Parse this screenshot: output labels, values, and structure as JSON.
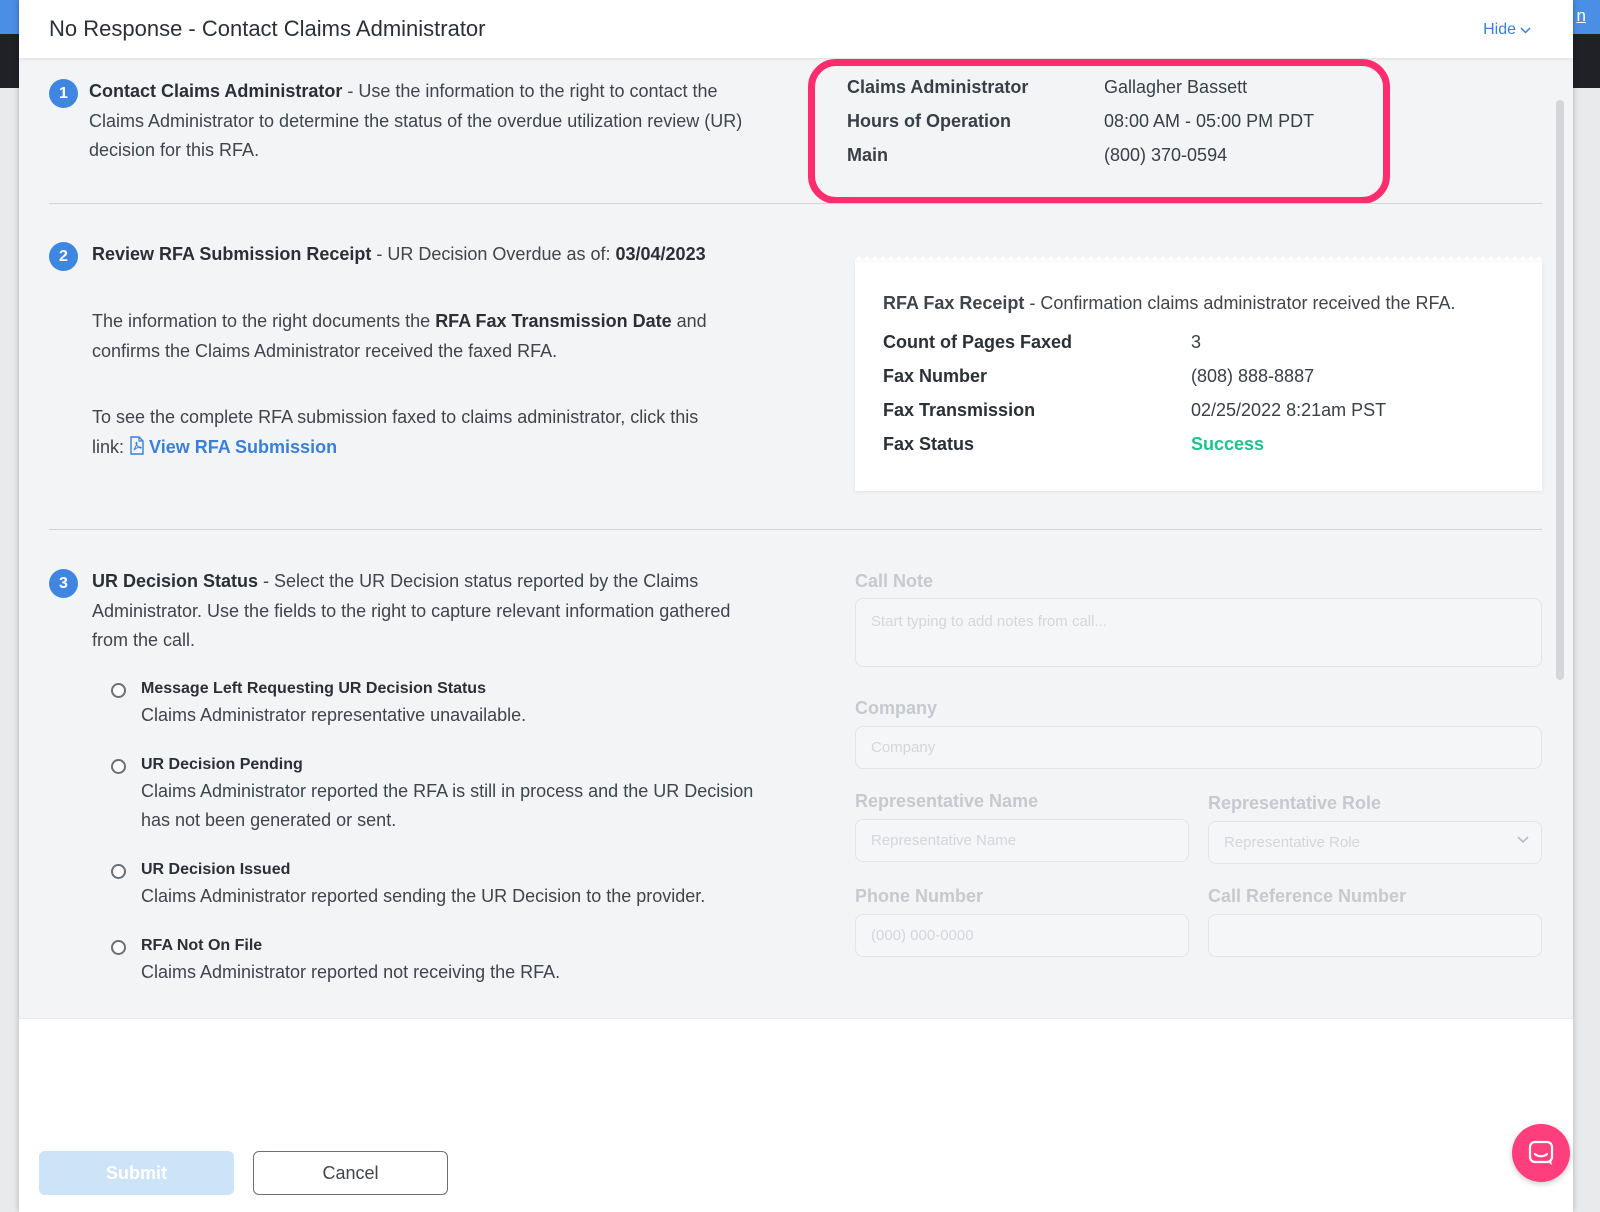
{
  "background": {
    "corner_link": "n"
  },
  "header": {
    "title": "No Response - Contact Claims Administrator",
    "hide_label": "Hide"
  },
  "step1": {
    "number": "1",
    "title": "Contact Claims Administrator",
    "text": " - Use the information to the right to contact the Claims Administrator to determine the status of the overdue utilization review (UR) decision for this RFA."
  },
  "claims_admin": {
    "rows": [
      {
        "label": "Claims Administrator",
        "value": "Gallagher Bassett"
      },
      {
        "label": "Hours of Operation",
        "value": "08:00 AM - 05:00 PM PDT"
      },
      {
        "label": "Main",
        "value": "(800) 370-0594"
      }
    ]
  },
  "step2": {
    "number": "2",
    "title": "Review RFA Submission Receipt",
    "subtitle": " - UR Decision Overdue as of: ",
    "date": "03/04/2023",
    "p1_a": "The information to the right documents the ",
    "p1_b": "RFA Fax Transmission Date",
    "p1_c": " and confirms the Claims Administrator received the faxed RFA.",
    "p2_a": "To see the complete RFA submission faxed to claims administrator, click this link: ",
    "link": "View RFA Submission"
  },
  "receipt": {
    "title": "RFA Fax Receipt",
    "subtitle": " - Confirmation claims administrator received the RFA.",
    "rows": [
      {
        "label": "Count of Pages Faxed",
        "value": "3"
      },
      {
        "label": "Fax Number",
        "value": "(808) 888-8887"
      },
      {
        "label": "Fax Transmission",
        "value": "02/25/2022 8:21am PST"
      },
      {
        "label": "Fax Status",
        "value": "Success"
      }
    ]
  },
  "step3": {
    "number": "3",
    "title": "UR Decision Status",
    "text": " - Select the UR Decision status reported by the Claims Administrator. Use the fields to the right to capture relevant information gathered from the call.",
    "options": [
      {
        "title": "Message Left Requesting UR Decision Status",
        "desc": "Claims Administrator representative unavailable."
      },
      {
        "title": "UR Decision Pending",
        "desc": "Claims Administrator reported the RFA is still in process and the UR Decision has not been generated or sent."
      },
      {
        "title": "UR Decision Issued",
        "desc": "Claims Administrator reported sending the UR Decision to the provider."
      },
      {
        "title": "RFA Not On File",
        "desc": "Claims Administrator reported not receiving the RFA."
      }
    ]
  },
  "form": {
    "call_note": {
      "label": "Call Note",
      "placeholder": "Start typing to add notes from call..."
    },
    "company": {
      "label": "Company",
      "placeholder": "Company"
    },
    "rep_name": {
      "label": "Representative Name",
      "placeholder": "Representative Name"
    },
    "rep_role": {
      "label": "Representative Role",
      "placeholder": "Representative Role"
    },
    "phone": {
      "label": "Phone Number",
      "placeholder": "(000) 000-0000"
    },
    "call_ref": {
      "label": "Call Reference Number",
      "placeholder": ""
    }
  },
  "footer": {
    "submit": "Submit",
    "cancel": "Cancel"
  },
  "colors": {
    "accent": "#3f86e0",
    "highlight": "#ff2d6e",
    "success": "#1ec28b",
    "chat": "#ff3f7d"
  }
}
